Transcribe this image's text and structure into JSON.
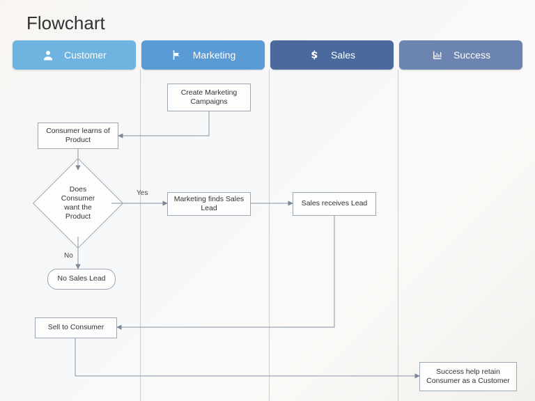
{
  "title": "Flowchart",
  "lanes": {
    "customer": {
      "label": "Customer",
      "icon": "person-icon",
      "bg": "#6FB3E0"
    },
    "marketing": {
      "label": "Marketing",
      "icon": "flag-icon",
      "bg": "#5B9BD5"
    },
    "sales": {
      "label": "Sales",
      "icon": "dollar-icon",
      "bg": "#4A6A9D"
    },
    "success": {
      "label": "Success",
      "icon": "chart-icon",
      "bg": "#6C84B0"
    }
  },
  "nodes": {
    "createCampaigns": "Create Marketing Campaigns",
    "learnsOfProduct": "Consumer learns of Product",
    "wantsProduct": "Does Consumer want the Product",
    "findsLead": "Marketing finds Sales Lead",
    "receivesLead": "Sales receives Lead",
    "noSalesLead": "No Sales Lead",
    "sellToConsumer": "Sell to Consumer",
    "retainCustomer": "Success help retain Consumer as a Customer"
  },
  "edgeLabels": {
    "yes": "Yes",
    "no": "No"
  }
}
